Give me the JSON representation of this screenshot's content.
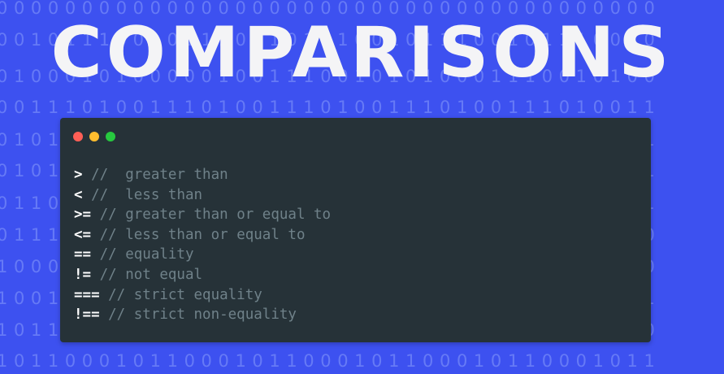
{
  "title": "COMPARISONS",
  "background": {
    "color": "#3d51f0",
    "binary_rows": [
      "000000000000000000000000000000000000000",
      "001011100101110010111001011100101110010",
      "010001010000010011100101010001110010100",
      "001110100111010011101001110100111010011",
      "010101001010100101010010101001010100101",
      "010111001011100101110010111001011100101",
      "011000111001101100011100110110001110011",
      "011100110001110011000111001100011100110",
      "100010010100010010100010010100010010100",
      "100101001010010100101001010010100101001",
      "101101011011010110110101101101011011010",
      "101100010110001011000101100010110001011"
    ]
  },
  "terminal": {
    "colors": {
      "background": "#263238",
      "operator": "#ffffff",
      "comment": "#6f8189"
    },
    "window_buttons": [
      "close",
      "minimize",
      "maximize"
    ],
    "lines": [
      {
        "op": ">",
        "comment": " //  greater than"
      },
      {
        "op": "<",
        "comment": " //  less than"
      },
      {
        "op": ">=",
        "comment": " // greater than or equal to"
      },
      {
        "op": "<=",
        "comment": " // less than or equal to"
      },
      {
        "op": "==",
        "comment": " // equality"
      },
      {
        "op": "!=",
        "comment": " // not equal"
      },
      {
        "op": "===",
        "comment": " // strict equality"
      },
      {
        "op": "!==",
        "comment": " // strict non-equality"
      }
    ]
  }
}
